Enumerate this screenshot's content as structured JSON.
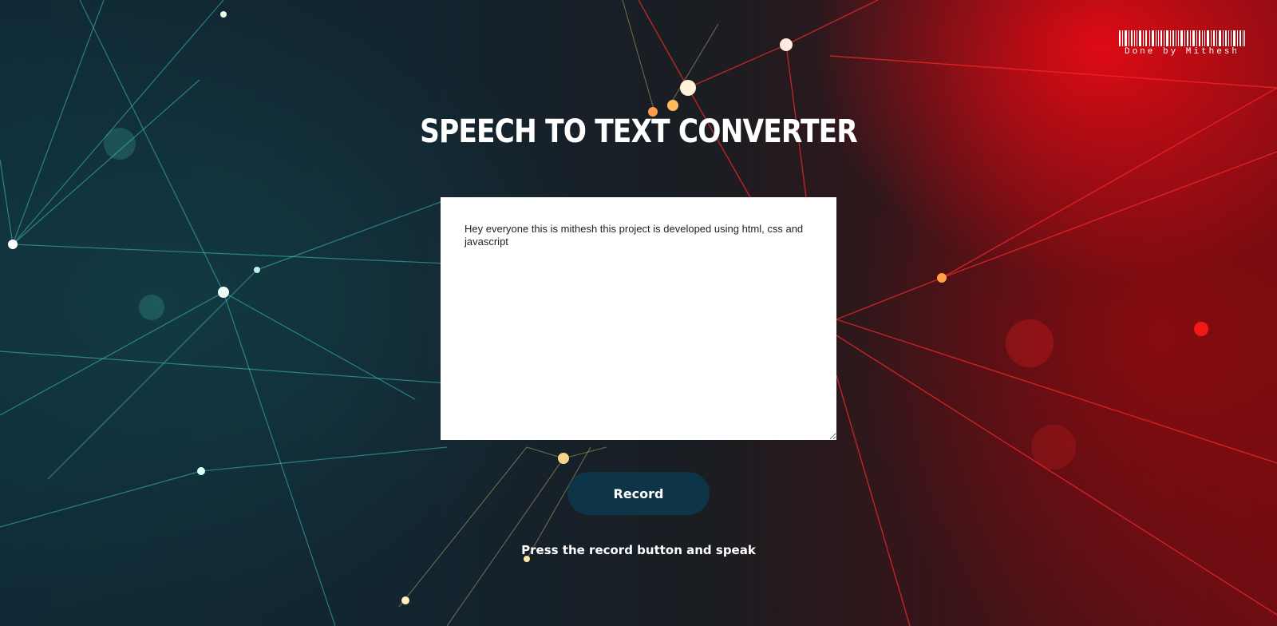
{
  "header": {
    "title": "SPEECH TO TEXT CONVERTER"
  },
  "brand": {
    "text": "Done by Mithesh",
    "icon": "barcode-icon"
  },
  "transcript": {
    "value": "Hey everyone this is mithesh this project is developed using html, css and javascript"
  },
  "controls": {
    "record_label": "Record"
  },
  "footer": {
    "instructions": "Press the record button and speak"
  },
  "colors": {
    "button_bg": "#0e3547",
    "text": "#ffffff",
    "accent_red": "#e00a14",
    "accent_teal": "#3ec1b5"
  }
}
